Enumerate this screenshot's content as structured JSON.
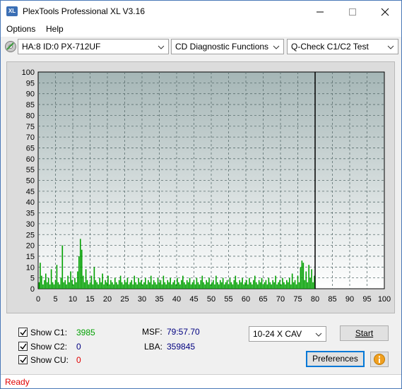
{
  "window": {
    "logo_text": "XL",
    "title": "PlexTools Professional XL V3.16"
  },
  "menu": [
    {
      "label": "Options"
    },
    {
      "label": "Help"
    }
  ],
  "toolbar": {
    "drive": "HA:8 ID:0  PX-712UF",
    "function": "CD Diagnostic Functions",
    "test": "Q-Check C1/C2 Test"
  },
  "chart_data": {
    "type": "bar",
    "xlim": [
      0,
      100
    ],
    "ylim": [
      0,
      100
    ],
    "x_ticks": [
      0,
      5,
      10,
      15,
      20,
      25,
      30,
      35,
      40,
      45,
      50,
      55,
      60,
      65,
      70,
      75,
      80,
      85,
      90,
      95,
      100
    ],
    "y_ticks": [
      0,
      5,
      10,
      15,
      20,
      25,
      30,
      35,
      40,
      45,
      50,
      55,
      60,
      65,
      70,
      75,
      80,
      85,
      90,
      95,
      100
    ],
    "grid": true,
    "end_marker_x": 80,
    "series": [
      {
        "color": "#00a000",
        "points": [
          [
            0.3,
            3
          ],
          [
            0.6,
            12
          ],
          [
            1.0,
            6
          ],
          [
            1.4,
            2
          ],
          [
            1.8,
            4
          ],
          [
            2.2,
            7
          ],
          [
            2.6,
            3
          ],
          [
            3.0,
            5
          ],
          [
            3.4,
            2
          ],
          [
            3.8,
            9
          ],
          [
            4.2,
            3
          ],
          [
            4.6,
            2
          ],
          [
            5.0,
            4
          ],
          [
            5.4,
            11
          ],
          [
            5.8,
            3
          ],
          [
            6.2,
            2
          ],
          [
            6.6,
            5
          ],
          [
            7.0,
            20
          ],
          [
            7.4,
            3
          ],
          [
            7.8,
            4
          ],
          [
            8.2,
            2
          ],
          [
            8.6,
            6
          ],
          [
            9.0,
            3
          ],
          [
            9.4,
            8
          ],
          [
            9.8,
            4
          ],
          [
            10.2,
            2
          ],
          [
            10.6,
            5
          ],
          [
            11.0,
            3
          ],
          [
            11.4,
            8
          ],
          [
            11.8,
            15
          ],
          [
            12.2,
            23
          ],
          [
            12.6,
            18
          ],
          [
            13.0,
            6
          ],
          [
            13.4,
            3
          ],
          [
            13.8,
            9
          ],
          [
            14.2,
            4
          ],
          [
            14.6,
            2
          ],
          [
            15.0,
            3
          ],
          [
            15.4,
            6
          ],
          [
            15.8,
            2
          ],
          [
            16.2,
            10
          ],
          [
            16.6,
            4
          ],
          [
            17.0,
            3
          ],
          [
            17.4,
            2
          ],
          [
            17.8,
            5
          ],
          [
            18.2,
            3
          ],
          [
            18.6,
            7
          ],
          [
            19.0,
            2
          ],
          [
            19.4,
            4
          ],
          [
            19.8,
            3
          ],
          [
            20.2,
            6
          ],
          [
            20.6,
            2
          ],
          [
            21.0,
            4
          ],
          [
            21.4,
            3
          ],
          [
            21.8,
            2
          ],
          [
            22.2,
            5
          ],
          [
            22.6,
            3
          ],
          [
            23.0,
            2
          ],
          [
            23.4,
            4
          ],
          [
            23.8,
            6
          ],
          [
            24.2,
            3
          ],
          [
            24.6,
            2
          ],
          [
            25.0,
            4
          ],
          [
            25.4,
            3
          ],
          [
            25.8,
            5
          ],
          [
            26.2,
            2
          ],
          [
            26.6,
            3
          ],
          [
            27.0,
            4
          ],
          [
            27.4,
            2
          ],
          [
            27.8,
            6
          ],
          [
            28.2,
            3
          ],
          [
            28.6,
            2
          ],
          [
            29.0,
            5
          ],
          [
            29.4,
            3
          ],
          [
            29.8,
            4
          ],
          [
            30.2,
            2
          ],
          [
            30.6,
            3
          ],
          [
            31.0,
            5
          ],
          [
            31.4,
            2
          ],
          [
            31.8,
            4
          ],
          [
            32.2,
            3
          ],
          [
            32.6,
            6
          ],
          [
            33.0,
            2
          ],
          [
            33.4,
            4
          ],
          [
            33.8,
            3
          ],
          [
            34.2,
            2
          ],
          [
            34.6,
            5
          ],
          [
            35.0,
            3
          ],
          [
            35.4,
            4
          ],
          [
            35.8,
            2
          ],
          [
            36.2,
            6
          ],
          [
            36.6,
            3
          ],
          [
            37.0,
            2
          ],
          [
            37.4,
            4
          ],
          [
            37.8,
            3
          ],
          [
            38.2,
            5
          ],
          [
            38.6,
            2
          ],
          [
            39.0,
            3
          ],
          [
            39.4,
            4
          ],
          [
            39.8,
            2
          ],
          [
            40.2,
            5
          ],
          [
            40.6,
            3
          ],
          [
            41.0,
            2
          ],
          [
            41.4,
            4
          ],
          [
            41.8,
            6
          ],
          [
            42.2,
            3
          ],
          [
            42.6,
            2
          ],
          [
            43.0,
            4
          ],
          [
            43.4,
            3
          ],
          [
            43.8,
            5
          ],
          [
            44.2,
            2
          ],
          [
            44.6,
            3
          ],
          [
            45.0,
            4
          ],
          [
            45.4,
            2
          ],
          [
            45.8,
            5
          ],
          [
            46.2,
            3
          ],
          [
            46.6,
            2
          ],
          [
            47.0,
            4
          ],
          [
            47.4,
            6
          ],
          [
            47.8,
            3
          ],
          [
            48.2,
            2
          ],
          [
            48.6,
            4
          ],
          [
            49.0,
            3
          ],
          [
            49.4,
            5
          ],
          [
            49.8,
            2
          ],
          [
            50.2,
            3
          ],
          [
            50.6,
            4
          ],
          [
            51.0,
            2
          ],
          [
            51.4,
            6
          ],
          [
            51.8,
            3
          ],
          [
            52.2,
            2
          ],
          [
            52.6,
            4
          ],
          [
            53.0,
            3
          ],
          [
            53.4,
            5
          ],
          [
            53.8,
            2
          ],
          [
            54.2,
            3
          ],
          [
            54.6,
            4
          ],
          [
            55.0,
            2
          ],
          [
            55.4,
            5
          ],
          [
            55.8,
            3
          ],
          [
            56.2,
            2
          ],
          [
            56.6,
            4
          ],
          [
            57.0,
            6
          ],
          [
            57.4,
            3
          ],
          [
            57.8,
            2
          ],
          [
            58.2,
            4
          ],
          [
            58.6,
            3
          ],
          [
            59.0,
            5
          ],
          [
            59.4,
            2
          ],
          [
            59.8,
            3
          ],
          [
            60.2,
            4
          ],
          [
            60.6,
            2
          ],
          [
            61.0,
            5
          ],
          [
            61.4,
            3
          ],
          [
            61.8,
            2
          ],
          [
            62.2,
            4
          ],
          [
            62.6,
            6
          ],
          [
            63.0,
            3
          ],
          [
            63.4,
            2
          ],
          [
            63.8,
            4
          ],
          [
            64.2,
            3
          ],
          [
            64.6,
            5
          ],
          [
            65.0,
            2
          ],
          [
            65.4,
            3
          ],
          [
            65.8,
            4
          ],
          [
            66.2,
            2
          ],
          [
            66.6,
            5
          ],
          [
            67.0,
            3
          ],
          [
            67.4,
            2
          ],
          [
            67.8,
            4
          ],
          [
            68.2,
            3
          ],
          [
            68.6,
            6
          ],
          [
            69.0,
            2
          ],
          [
            69.4,
            3
          ],
          [
            69.8,
            4
          ],
          [
            70.2,
            2
          ],
          [
            70.6,
            5
          ],
          [
            71.0,
            3
          ],
          [
            71.4,
            2
          ],
          [
            71.8,
            4
          ],
          [
            72.2,
            3
          ],
          [
            72.6,
            5
          ],
          [
            73.0,
            2
          ],
          [
            73.4,
            7
          ],
          [
            73.8,
            3
          ],
          [
            74.2,
            4
          ],
          [
            74.6,
            2
          ],
          [
            75.0,
            6
          ],
          [
            75.4,
            3
          ],
          [
            75.8,
            10
          ],
          [
            76.2,
            13
          ],
          [
            76.6,
            12
          ],
          [
            77.0,
            4
          ],
          [
            77.4,
            8
          ],
          [
            77.8,
            3
          ],
          [
            78.2,
            11
          ],
          [
            78.6,
            5
          ],
          [
            79.0,
            9
          ],
          [
            79.4,
            3
          ],
          [
            79.8,
            6
          ]
        ]
      }
    ]
  },
  "bottom": {
    "show_c1": {
      "label": "Show C1:",
      "value": "3985",
      "checked": true
    },
    "show_c2": {
      "label": "Show C2:",
      "value": "0",
      "checked": true
    },
    "show_cu": {
      "label": "Show CU:",
      "value": "0",
      "checked": true
    },
    "msf_label": "MSF:",
    "msf_value": "79:57.70",
    "lba_label": "LBA:",
    "lba_value": "359845",
    "speed": "10-24 X CAV",
    "start_label": "Start",
    "preferences_label": "Preferences"
  },
  "status": "Ready"
}
